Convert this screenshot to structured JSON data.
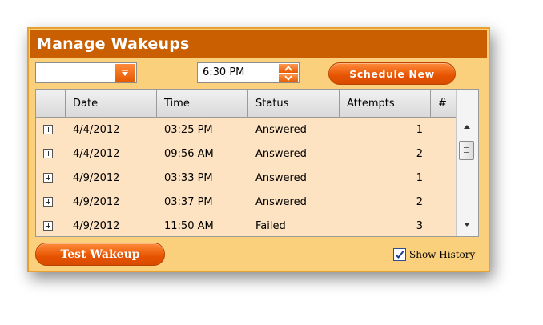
{
  "panel": {
    "title": "Manage Wakeups"
  },
  "controls": {
    "dropdown_value": "",
    "time_value": "6:30 PM",
    "schedule_label": "Schedule New",
    "test_label": "Test Wakeup",
    "show_history_label": "Show History",
    "show_history_checked": true
  },
  "grid": {
    "columns": [
      "",
      "Date",
      "Time",
      "Status",
      "Attempts",
      "#"
    ],
    "rows": [
      {
        "date": "4/4/2012",
        "time": "03:25 PM",
        "status": "Answered",
        "attempts": "1",
        "num": ""
      },
      {
        "date": "4/4/2012",
        "time": "09:56 AM",
        "status": "Answered",
        "attempts": "2",
        "num": ""
      },
      {
        "date": "4/9/2012",
        "time": "03:33 PM",
        "status": "Answered",
        "attempts": "1",
        "num": ""
      },
      {
        "date": "4/9/2012",
        "time": "03:37 PM",
        "status": "Answered",
        "attempts": "2",
        "num": ""
      },
      {
        "date": "4/9/2012",
        "time": "11:50 AM",
        "status": "Failed",
        "attempts": "3",
        "num": ""
      }
    ]
  },
  "colors": {
    "title_bar": "#c95f00",
    "panel_bg": "#fbd07c",
    "accent_button": "#e65300",
    "row_bg": "#fde3c2"
  },
  "icons": {
    "dropdown": "chevron-down-icon",
    "spin_up": "chevron-up-icon",
    "spin_down": "chevron-down-icon",
    "expand": "plus-box-icon",
    "check": "checkmark-icon"
  }
}
